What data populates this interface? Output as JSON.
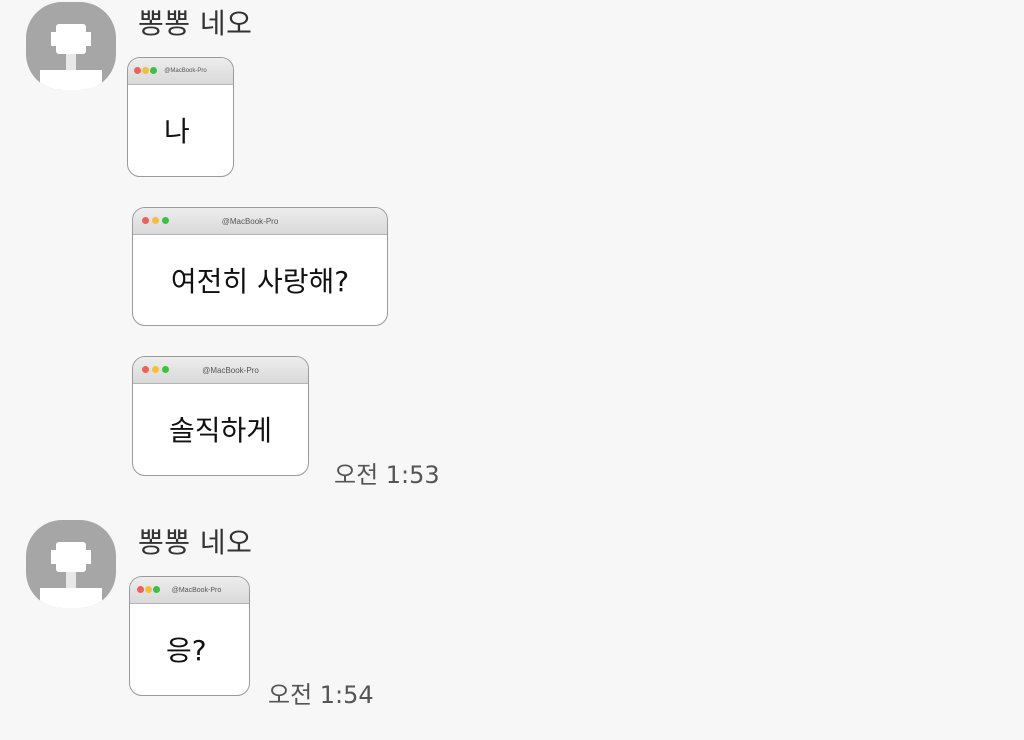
{
  "groups": [
    {
      "sender": "뽕뽕 네오",
      "messages": [
        {
          "text": "나",
          "window_title": "@MacBook-Pro"
        },
        {
          "text": "여전히 사랑해?",
          "window_title": "@MacBook-Pro"
        },
        {
          "text": "솔직하게",
          "window_title": "@MacBook-Pro"
        }
      ],
      "time": "오전 1:53"
    },
    {
      "sender": "뽕뽕 네오",
      "messages": [
        {
          "text": "응?",
          "window_title": "@MacBook-Pro"
        }
      ],
      "time": "오전 1:54"
    }
  ],
  "colors": {
    "background": "#f7f7f7",
    "avatar": "#a6a6a6",
    "dot_red": "#f0605a",
    "dot_yellow": "#f5bd3d",
    "dot_green": "#3dc042"
  },
  "icons": [
    "default-avatar-icon",
    "close-dot-icon",
    "minimize-dot-icon",
    "zoom-dot-icon"
  ]
}
